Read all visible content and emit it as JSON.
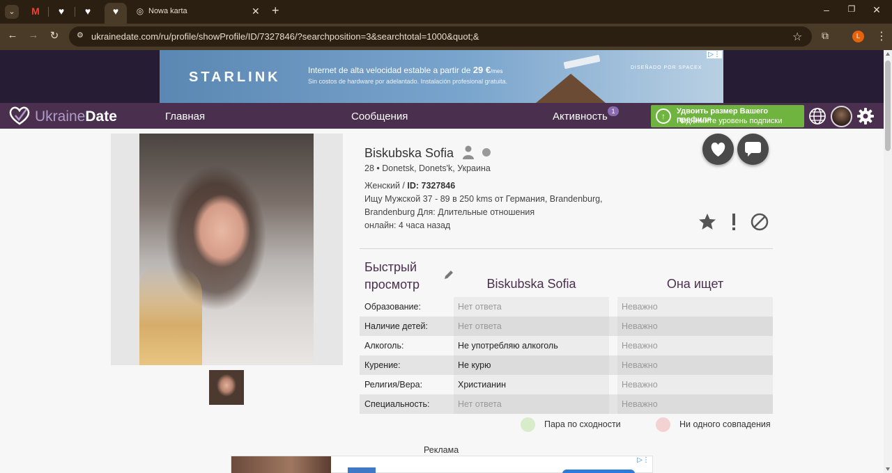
{
  "browser": {
    "tabs": [
      {
        "icon": "gmail-icon",
        "label": "M"
      },
      {
        "icon": "ukrainedate-heart-icon",
        "label": "♥"
      },
      {
        "icon": "ukrainedate-heart-icon",
        "label": "♥"
      },
      {
        "icon": "ukrainedate-heart-icon",
        "label": "♥"
      },
      {
        "icon": "chrome-icon",
        "label": "Nowa karta"
      }
    ],
    "new_tab_title": "Nowa karta",
    "url": "ukrainedate.com/ru/profile/showProfile/ID/7327846/?searchposition=3&searchtotal=1000&quot;&",
    "profile_initial": "L",
    "profile_color": "#e8620c"
  },
  "ad_banner": {
    "brand": "STARLINK",
    "line1_prefix": "Internet de alta velocidad estable a partir de ",
    "line1_price": "29 €",
    "line1_suffix": "/mes",
    "line2": "Sin costos de hardware por adelantado. Instalación profesional gratuita.",
    "tag": "DISEÑADO POR SPACEX"
  },
  "site": {
    "logo_light": "Ukraine",
    "logo_bold": "Date",
    "nav": {
      "home": "Главная",
      "messages": "Сообщения",
      "activity": "Активность",
      "activity_badge": "1"
    },
    "upgrade": {
      "line1": "Удвоить размер Вашего профиля",
      "line2": "Поднимите уровень подписки"
    },
    "colors": {
      "navbar": "#4b2f4e",
      "upgrade": "#6eb43f",
      "accent": "#4b2f4e"
    }
  },
  "profile": {
    "name": "Biskubska Sofia",
    "age_location": "28 • Donetsk, Donets'k, Украина",
    "gender_prefix": "Женский / ",
    "id_label": "ID: 7327846",
    "seeking_line1": "Ищу Мужской 37 - 89 в 250 kms от Германия, Brandenburg,",
    "seeking_line2": "Brandenburg Для: Длительные отношения",
    "online": "онлайн: 4 часа назад"
  },
  "quick_view": {
    "title_line1": "Быстрый",
    "title_line2": "просмотр",
    "col_her": "Biskubska Sofia",
    "col_seeking": "Она ищет",
    "rows": [
      {
        "label": "Образование:",
        "her": "Нет ответа",
        "her_muted": true,
        "seeking": "Неважно"
      },
      {
        "label": "Наличие детей:",
        "her": "Нет ответа",
        "her_muted": true,
        "seeking": "Неважно"
      },
      {
        "label": "Алкоголь:",
        "her": "Не употребляю алкоголь",
        "her_muted": false,
        "seeking": "Неважно"
      },
      {
        "label": "Курение:",
        "her": "Не курю",
        "her_muted": false,
        "seeking": "Неважно"
      },
      {
        "label": "Религия/Вера:",
        "her": "Христианин",
        "her_muted": false,
        "seeking": "Неважно"
      },
      {
        "label": "Специальность:",
        "her": "Нет ответа",
        "her_muted": true,
        "seeking": "Неважно"
      }
    ],
    "legend_match": "Пара по сходности",
    "legend_match_color": "#d8ecc9",
    "legend_nomatch": "Ни одного совпадения",
    "legend_nomatch_color": "#f5d2d2"
  },
  "ads_label": "Реклама"
}
